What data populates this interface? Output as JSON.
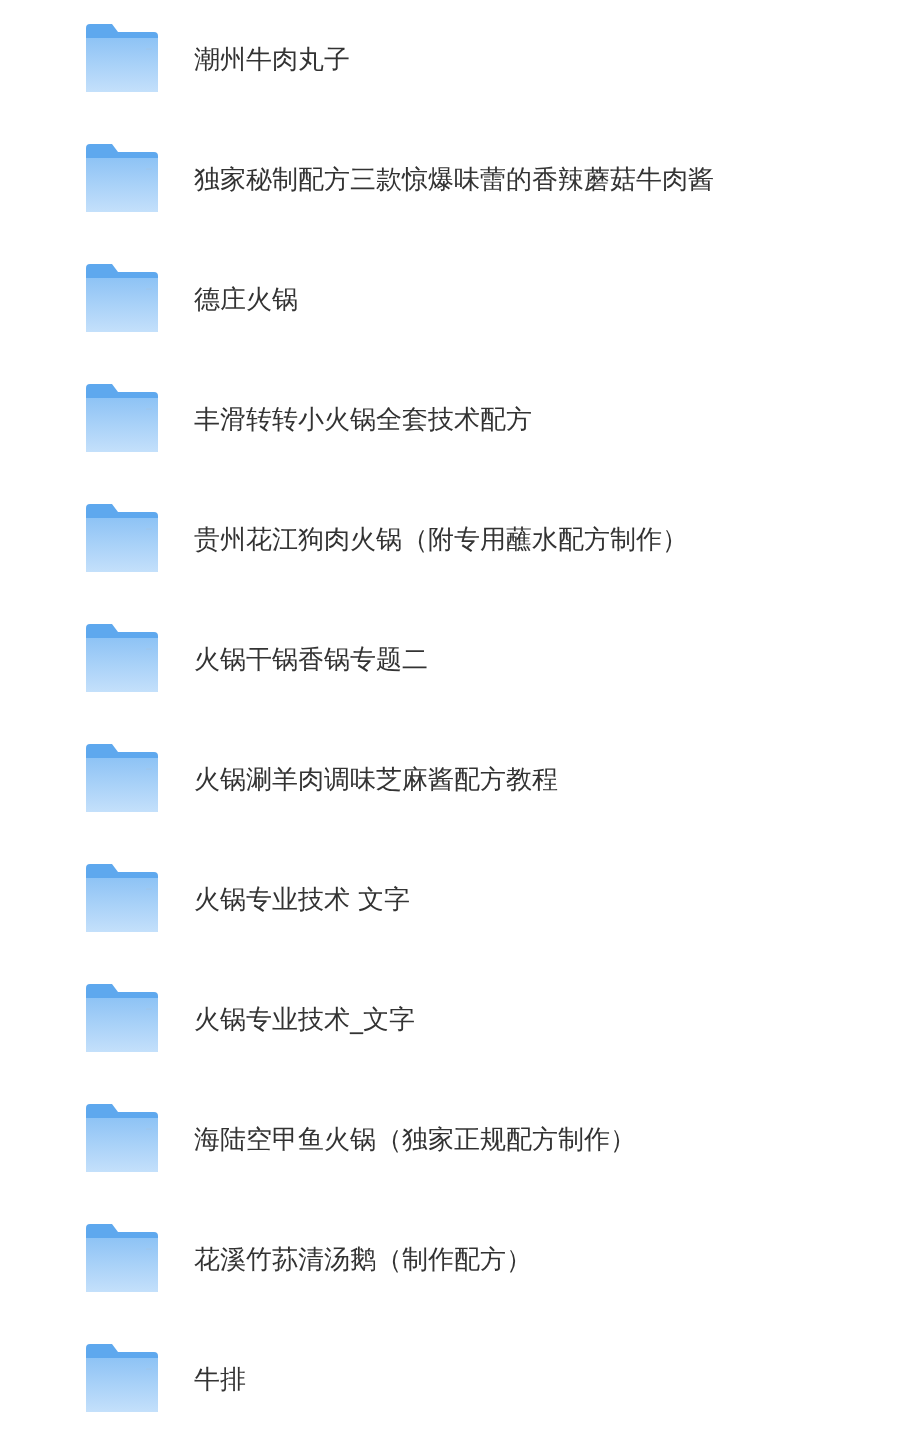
{
  "folders": [
    {
      "name": "潮州牛肉丸子"
    },
    {
      "name": "独家秘制配方三款惊爆味蕾的香辣蘑菇牛肉酱"
    },
    {
      "name": "德庄火锅"
    },
    {
      "name": "丰滑转转小火锅全套技术配方"
    },
    {
      "name": "贵州花江狗肉火锅（附专用蘸水配方制作）"
    },
    {
      "name": "火锅干锅香锅专题二"
    },
    {
      "name": "火锅涮羊肉调味芝麻酱配方教程"
    },
    {
      "name": "火锅专业技术 文字"
    },
    {
      "name": "火锅专业技术_文字"
    },
    {
      "name": "海陆空甲鱼火锅（独家正规配方制作）"
    },
    {
      "name": "花溪竹荪清汤鹅（制作配方）"
    },
    {
      "name": "牛排"
    }
  ]
}
